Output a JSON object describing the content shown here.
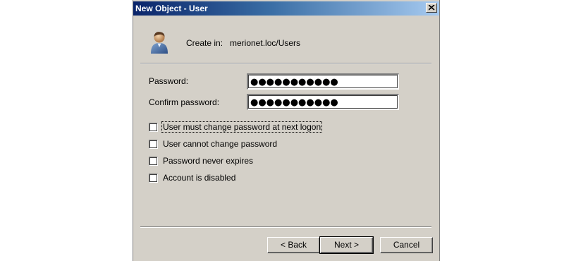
{
  "window": {
    "title": "New Object - User",
    "close_glyph": "close-icon"
  },
  "header": {
    "icon": "user-icon",
    "create_in_label": "Create in:",
    "create_in_path": "merionet.loc/Users"
  },
  "form": {
    "password_label": "Password:",
    "password_value": "●●●●●●●●●●●",
    "confirm_label": "Confirm password:",
    "confirm_value": "●●●●●●●●●●●"
  },
  "options": [
    {
      "label": "User must change password at next logon",
      "checked": false
    },
    {
      "label": "User cannot change password",
      "checked": false
    },
    {
      "label": "Password never expires",
      "checked": false
    },
    {
      "label": "Account is disabled",
      "checked": false
    }
  ],
  "buttons": {
    "back": "< Back",
    "next": "Next >",
    "cancel": "Cancel"
  }
}
